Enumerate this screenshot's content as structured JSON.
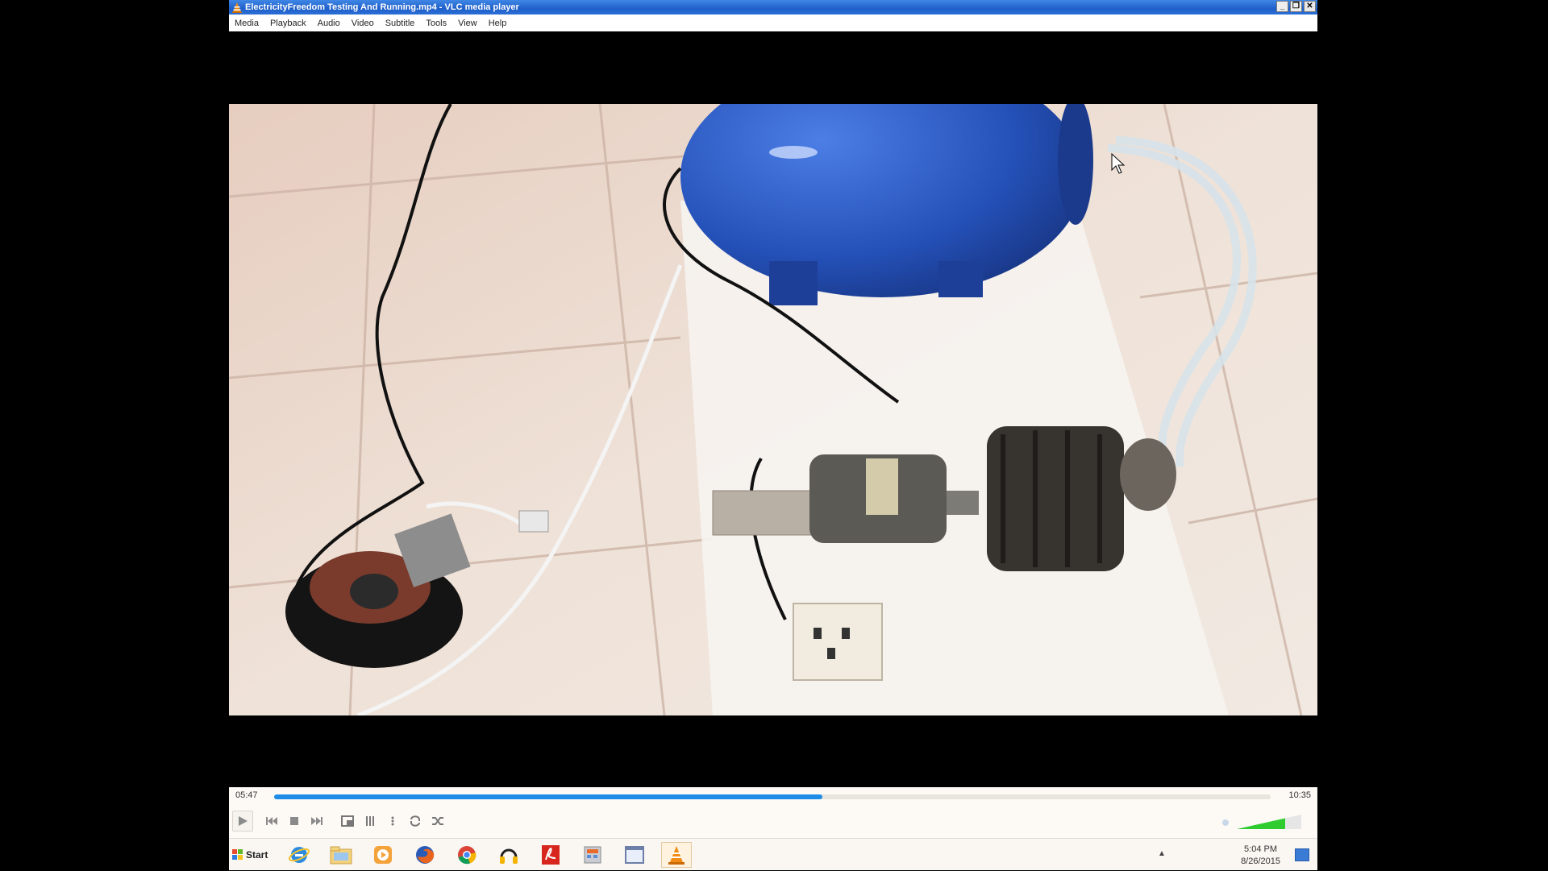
{
  "window": {
    "title": "ElectricityFreedom Testing And Running.mp4 - VLC media player",
    "buttons": {
      "minimize": "_",
      "restore": "❐",
      "close": "✕"
    }
  },
  "menu": [
    "Media",
    "Playback",
    "Audio",
    "Video",
    "Subtitle",
    "Tools",
    "View",
    "Help"
  ],
  "player": {
    "elapsed": "05:47",
    "duration": "10:35",
    "progress_fraction": 0.55,
    "volume_fraction": 0.75
  },
  "taskbar": {
    "start_label": "Start",
    "icons": [
      "internet-explorer-icon",
      "folder-icon",
      "media-player-icon",
      "firefox-icon",
      "chrome-icon",
      "headphones-icon",
      "acrobat-icon",
      "calculator-icon",
      "window-icon",
      "vlc-icon"
    ],
    "clock_time": "5:04 PM",
    "clock_date": "8/26/2015"
  },
  "colors": {
    "titlebar": "#2b6fd6",
    "seek_fill": "#1f8de8",
    "volume": "#2ecc2e",
    "vlc_orange": "#f28c16"
  }
}
